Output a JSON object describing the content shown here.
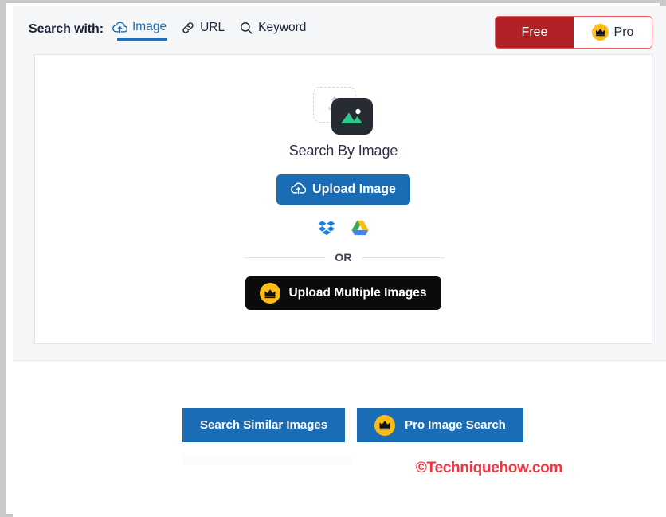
{
  "header": {
    "search_with_label": "Search with:",
    "tabs": [
      {
        "label": "Image",
        "icon": "cloud-upload-icon",
        "active": true
      },
      {
        "label": "URL",
        "icon": "link-icon",
        "active": false
      },
      {
        "label": "Keyword",
        "icon": "search-icon",
        "active": false
      }
    ],
    "plan_toggle": {
      "free_label": "Free",
      "pro_label": "Pro",
      "pro_icon": "crown-icon",
      "active": "Free"
    }
  },
  "card": {
    "icon_name": "image-placeholder-icon",
    "title": "Search By Image",
    "upload_button": {
      "label": "Upload Image",
      "icon": "cloud-upload-icon"
    },
    "cloud_sources": [
      {
        "name": "dropbox-icon",
        "label": "Dropbox"
      },
      {
        "name": "google-drive-icon",
        "label": "Google Drive"
      }
    ],
    "divider_label": "OR",
    "multi_upload_button": {
      "label": "Upload Multiple Images",
      "icon": "crown-icon"
    }
  },
  "footer": {
    "actions": [
      {
        "label": "Search Similar Images",
        "icon": ""
      },
      {
        "label": "Pro Image Search",
        "icon": "crown-icon"
      }
    ],
    "watermark": "©Techniquehow.com"
  },
  "colors": {
    "primary_blue": "#1a6cb5",
    "free_red": "#b02025",
    "crown_yellow": "#fbbc16",
    "black_button": "#0b0b0b",
    "watermark_red": "#f5333f",
    "panel_bg": "#f5f6f8"
  }
}
